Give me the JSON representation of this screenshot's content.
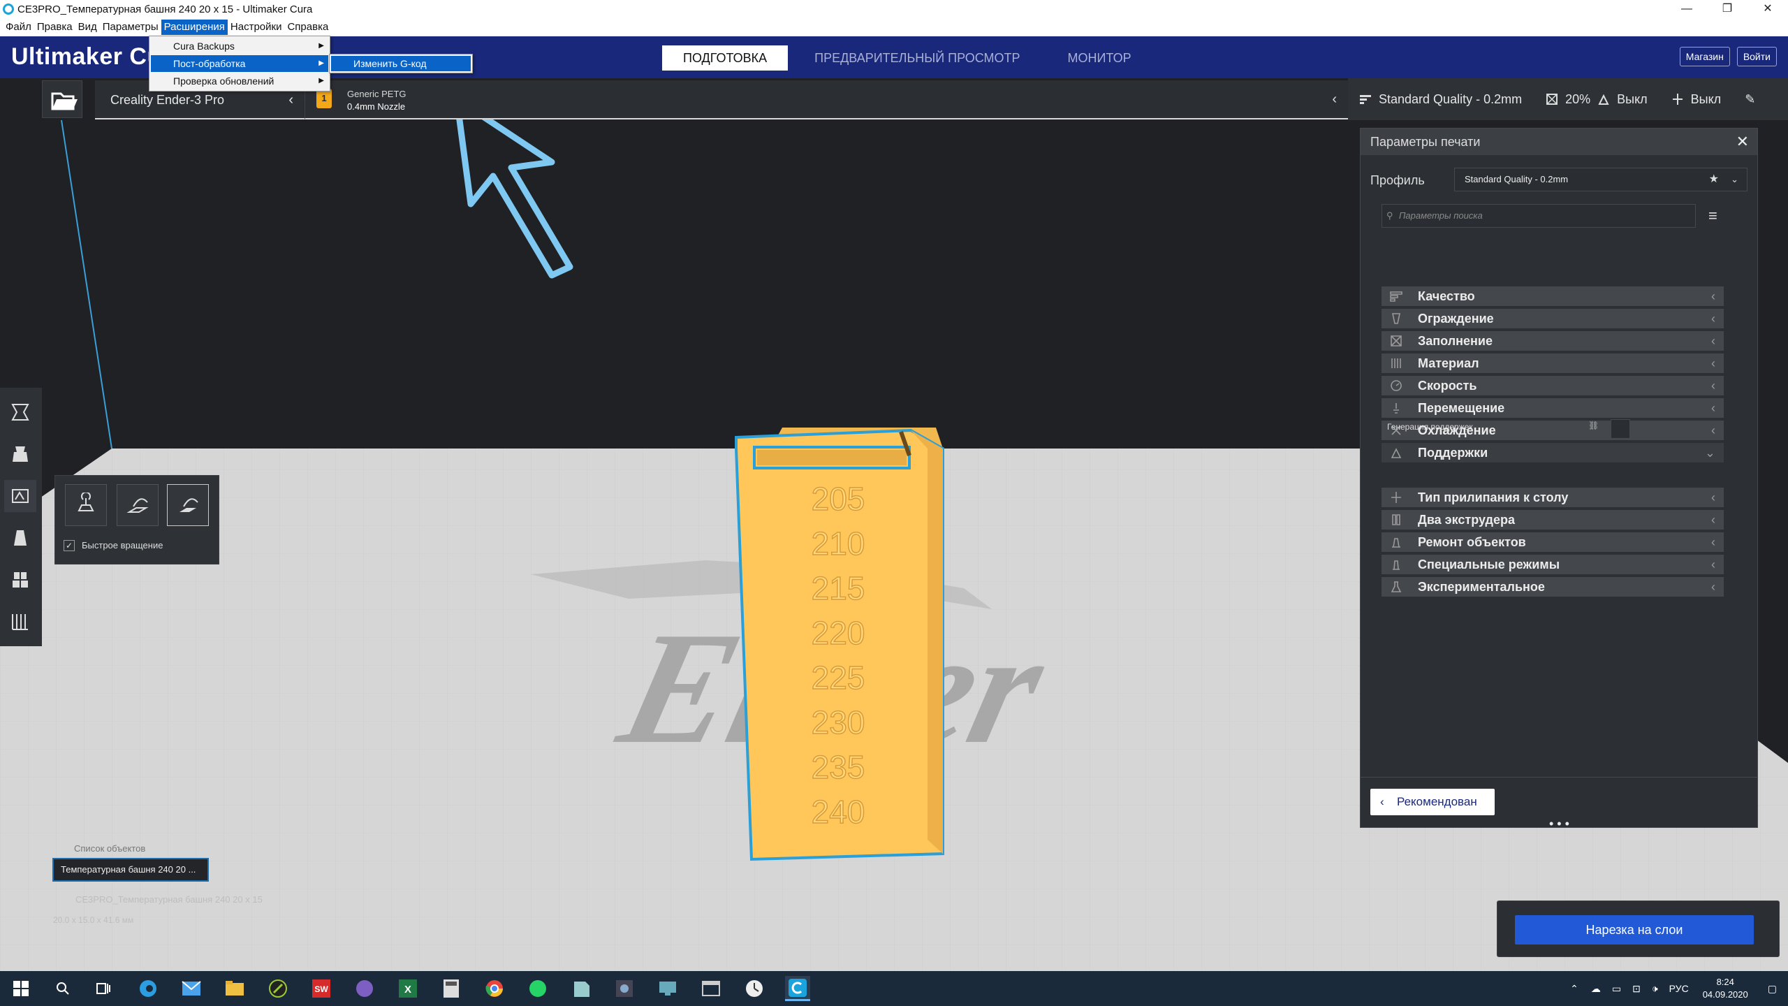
{
  "window": {
    "title": "CE3PRO_Температурная башня 240 20 x 15 - Ultimaker Cura",
    "minimize": "—",
    "maximize": "❐",
    "close": "✕"
  },
  "menubar": [
    "Файл",
    "Правка",
    "Вид",
    "Параметры",
    "Расширения",
    "Настройки",
    "Справка"
  ],
  "extensions_menu": {
    "items": [
      "Cura Backups",
      "Пост-обработка",
      "Проверка обновлений"
    ],
    "submenu_item": "Изменить G-код"
  },
  "header": {
    "logo": "Ultimaker Cura",
    "stages": [
      "ПОДГОТОВКА",
      "ПРЕДВАРИТЕЛЬНЫЙ ПРОСМОТР",
      "МОНИТОР"
    ],
    "marketplace": "Магазин",
    "signin": "Войти"
  },
  "printer": {
    "name": "Creality Ender-3 Pro"
  },
  "material": {
    "badge": "1",
    "name": "Generic PETG",
    "nozzle": "0.4mm Nozzle"
  },
  "quality_bar": {
    "profile": "Standard Quality - 0.2mm",
    "infill": "20%",
    "support": "Выкл",
    "adhesion": "Выкл"
  },
  "rotate_panel": {
    "snap_label": "Быстрое вращение",
    "snap_checked": true
  },
  "objects": {
    "title": "Список объектов",
    "item": "Температурная башня 240 20 ...",
    "file": "CE3PRO_Температурная башня 240 20 x 15",
    "dims": "20.0 x 15.0 x 41.6 мм"
  },
  "model_labels": [
    "205",
    "210",
    "215",
    "220",
    "225",
    "230",
    "235",
    "240"
  ],
  "print_settings": {
    "title": "Параметры печати",
    "profile_label": "Профиль",
    "profile_value": "Standard Quality - 0.2mm",
    "search_placeholder": "Параметры поиска",
    "categories": [
      {
        "label": "Качество",
        "icon": "quality-icon"
      },
      {
        "label": "Ограждение",
        "icon": "shell-icon"
      },
      {
        "label": "Заполнение",
        "icon": "infill-icon"
      },
      {
        "label": "Материал",
        "icon": "material-icon"
      },
      {
        "label": "Скорость",
        "icon": "speed-icon"
      },
      {
        "label": "Перемещение",
        "icon": "travel-icon"
      },
      {
        "label": "Охлаждение",
        "icon": "cooling-icon"
      },
      {
        "label": "Поддержки",
        "icon": "support-icon"
      },
      {
        "label": "Тип прилипания к столу",
        "icon": "adhesion-icon"
      },
      {
        "label": "Два экструдера",
        "icon": "dual-extrusion-icon"
      },
      {
        "label": "Ремонт объектов",
        "icon": "mesh-fixes-icon"
      },
      {
        "label": "Специальные режимы",
        "icon": "special-modes-icon"
      },
      {
        "label": "Экспериментальное",
        "icon": "experimental-icon"
      }
    ],
    "support_sub": "Генерация поддержек",
    "recommended_btn": "Рекомендован"
  },
  "slice_button": "Нарезка на слои",
  "taskbar": {
    "lang": "РУС",
    "time": "8:24",
    "date": "04.09.2020"
  },
  "colors": {
    "header": "#19287a",
    "accent": "#2259d6",
    "model": "#ffc75a",
    "model_outline": "#2a9fd8",
    "annotation_arrow": "#7ec8f2"
  }
}
